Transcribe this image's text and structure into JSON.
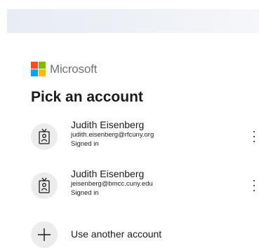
{
  "brand": {
    "name": "Microsoft",
    "logo_colors": [
      "#f25022",
      "#7fba00",
      "#00a4ef",
      "#ffb900"
    ]
  },
  "title": "Pick an account",
  "accounts": [
    {
      "name": "Judith Eisenberg",
      "email": "judith.eisenberg@rfcuny.org",
      "status": "Signed in",
      "icon": "person-badge-icon",
      "menu_icon": "more-options-icon"
    },
    {
      "name": "Judith Eisenberg",
      "email": "jeisenberg@bmcc.cuny.edu",
      "status": "Signed in",
      "icon": "person-badge-icon",
      "menu_icon": "more-options-icon"
    }
  ],
  "use_another": {
    "label": "Use another account",
    "icon": "plus-icon"
  }
}
